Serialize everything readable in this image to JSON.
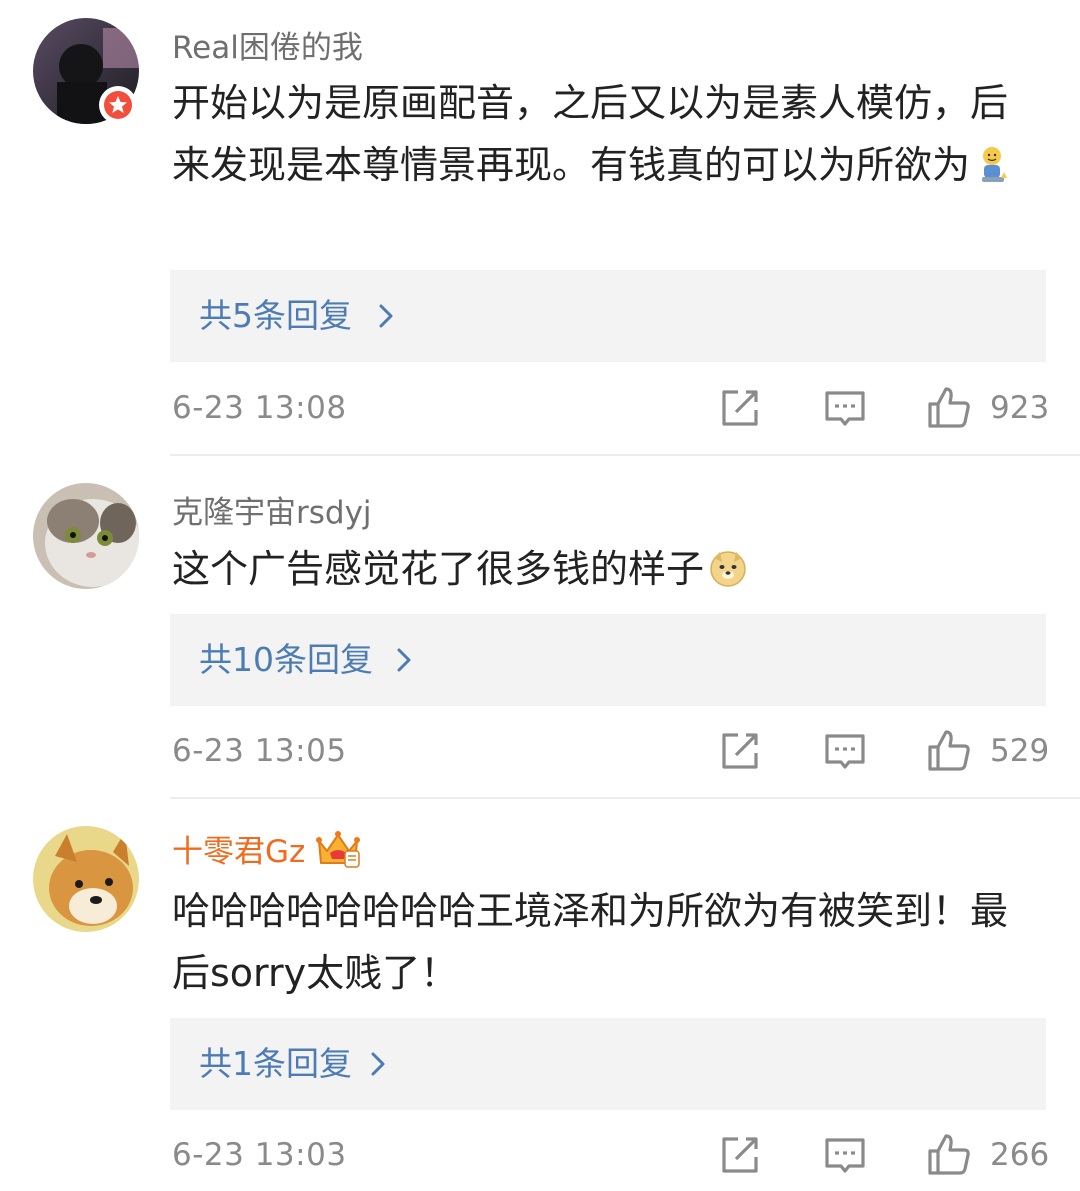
{
  "comments": [
    {
      "username": "Real困倦的我",
      "content": "开始以为是原画配音，之后又以为是素人模仿，后来发现是本尊情景再现。有钱真的可以为所欲为",
      "emoji": "sitting-shrug-emoji",
      "reply_label": "共5条回复",
      "time": "6-23 13:08",
      "likes": "923",
      "verified": true
    },
    {
      "username": "克隆宇宙rsdyj",
      "content": "这个广告感觉花了很多钱的样子",
      "emoji": "doge-emoji",
      "reply_label": "共10条回复",
      "time": "6-23 13:05",
      "likes": "529"
    },
    {
      "username": "十零君Gz",
      "content": "哈哈哈哈哈哈哈哈王境泽和为所欲为有被笑到！最后sorry太贱了！",
      "reply_label": "共1条回复",
      "time": "6-23 13:03",
      "likes": "266",
      "vip": true
    }
  ],
  "colors": {
    "username": "#6f6f6f",
    "vip_username": "#f06b1e",
    "reply_link": "#4d7cb5",
    "reply_bg": "#f3f3f3",
    "meta_text": "#8a8a8a"
  },
  "icons": [
    "share-icon",
    "comment-icon",
    "like-icon",
    "chevron-right-icon",
    "verified-badge-icon",
    "vip-crown-icon"
  ]
}
